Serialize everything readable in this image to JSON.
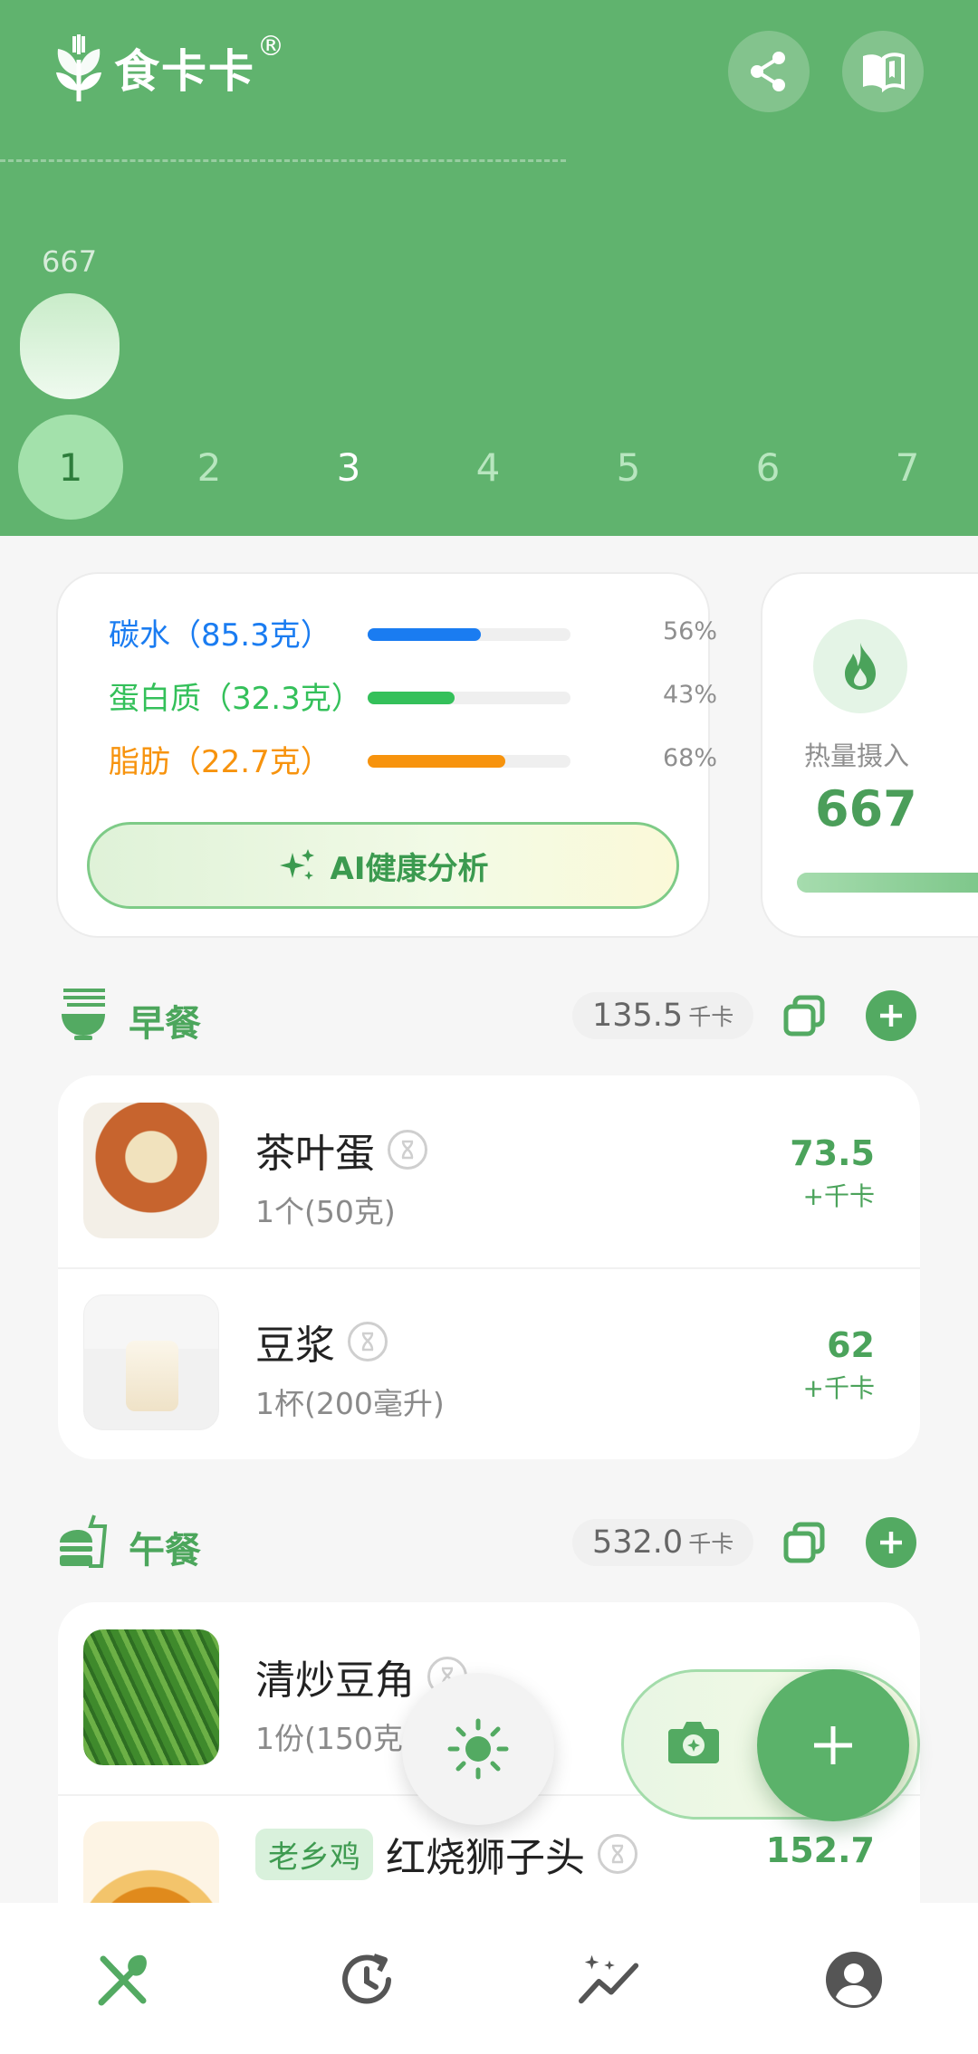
{
  "app": {
    "name": "食卡卡",
    "reg_mark": "®"
  },
  "header": {
    "share_icon": "share-icon",
    "guide_icon": "book-icon",
    "bar_value": "667",
    "days": [
      "1",
      "2",
      "3",
      "4",
      "5",
      "6",
      "7"
    ],
    "active_day_index": 0
  },
  "macros": {
    "items": [
      {
        "label": "碳水（85.3克）",
        "percent": "56%",
        "fill": 0.56,
        "color": "#1a7cf1"
      },
      {
        "label": "蛋白质（32.3克）",
        "percent": "43%",
        "fill": 0.43,
        "color": "#34c05a"
      },
      {
        "label": "脂肪（22.7克）",
        "percent": "68%",
        "fill": 0.68,
        "color": "#f7930d"
      }
    ],
    "ai_button": "AI健康分析"
  },
  "calorie": {
    "label": "热量摄入",
    "value": "667"
  },
  "meals": {
    "breakfast": {
      "title": "早餐",
      "kcal": "135.5",
      "kcal_unit": "千卡",
      "foods": [
        {
          "name": "茶叶蛋",
          "amount": "1个(50克)",
          "kcal": "73.5",
          "unit": "+千卡"
        },
        {
          "name": "豆浆",
          "amount": "1杯(200毫升)",
          "kcal": "62",
          "unit": "+千卡"
        }
      ]
    },
    "lunch": {
      "title": "午餐",
      "kcal": "532.0",
      "kcal_unit": "千卡",
      "foods": [
        {
          "name": "清炒豆角",
          "amount": "1份(150克",
          "kcal": "",
          "unit": ""
        },
        {
          "tag": "老乡鸡",
          "name": "红烧狮子头",
          "amount": "",
          "kcal": "152.7",
          "unit": ""
        }
      ]
    }
  },
  "colors": {
    "primary": "#60b36e",
    "accent_text": "#4ba35b"
  },
  "nav": [
    "food-icon",
    "history-icon",
    "trend-icon",
    "profile-icon"
  ]
}
